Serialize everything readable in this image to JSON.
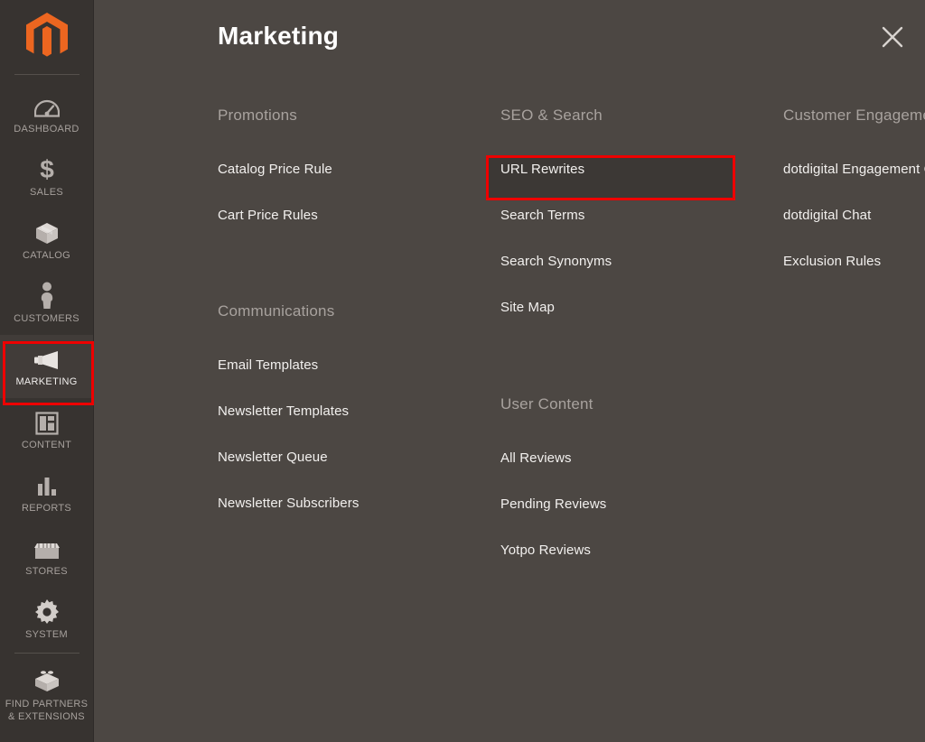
{
  "sidebar": {
    "logo": {
      "icon": "magento-logo-icon",
      "color": "#ec6620"
    },
    "items": [
      {
        "id": "dashboard",
        "label": "DASHBOARD",
        "icon": "dashboard-gauge-icon",
        "active": false
      },
      {
        "id": "sales",
        "label": "SALES",
        "icon": "dollar-sign-icon",
        "active": false
      },
      {
        "id": "catalog",
        "label": "CATALOG",
        "icon": "box-icon",
        "active": false
      },
      {
        "id": "customers",
        "label": "CUSTOMERS",
        "icon": "person-icon",
        "active": false
      },
      {
        "id": "marketing",
        "label": "MARKETING",
        "icon": "megaphone-icon",
        "active": true
      },
      {
        "id": "content",
        "label": "CONTENT",
        "icon": "layout-panel-icon",
        "active": false
      },
      {
        "id": "reports",
        "label": "REPORTS",
        "icon": "bar-chart-icon",
        "active": false
      },
      {
        "id": "stores",
        "label": "STORES",
        "icon": "storefront-icon",
        "active": false
      },
      {
        "id": "system",
        "label": "SYSTEM",
        "icon": "gear-icon",
        "active": false
      },
      {
        "id": "find-partners",
        "label": "FIND PARTNERS\n& EXTENSIONS",
        "label_line1": "FIND PARTNERS",
        "label_line2": "& EXTENSIONS",
        "icon": "lego-brick-icon",
        "active": false
      }
    ]
  },
  "panel": {
    "title": "Marketing",
    "close_icon": "close-x-icon",
    "groups": [
      {
        "id": "promotions",
        "title": "Promotions",
        "items": [
          {
            "label": "Catalog Price Rule",
            "highlighted": false
          },
          {
            "label": "Cart Price Rules",
            "highlighted": false
          }
        ]
      },
      {
        "id": "communications",
        "title": "Communications",
        "items": [
          {
            "label": "Email Templates",
            "highlighted": false
          },
          {
            "label": "Newsletter Templates",
            "highlighted": false
          },
          {
            "label": "Newsletter Queue",
            "highlighted": false
          },
          {
            "label": "Newsletter Subscribers",
            "highlighted": false
          }
        ]
      },
      {
        "id": "seo-search",
        "title": "SEO & Search",
        "items": [
          {
            "label": "URL Rewrites",
            "highlighted": true
          },
          {
            "label": "Search Terms",
            "highlighted": false
          },
          {
            "label": "Search Synonyms",
            "highlighted": false
          },
          {
            "label": "Site Map",
            "highlighted": false
          }
        ]
      },
      {
        "id": "user-content",
        "title": "User Content",
        "items": [
          {
            "label": "All Reviews",
            "highlighted": false
          },
          {
            "label": "Pending Reviews",
            "highlighted": false
          },
          {
            "label": "Yotpo Reviews",
            "highlighted": false
          }
        ]
      },
      {
        "id": "customer-engagement",
        "title": "Customer Engagement",
        "items": [
          {
            "label": "dotdigital Engagement Cloud",
            "highlighted": false
          },
          {
            "label": "dotdigital Chat",
            "highlighted": false
          },
          {
            "label": "Exclusion Rules",
            "highlighted": false
          }
        ]
      }
    ]
  },
  "highlights": {
    "color": "#ee0000",
    "sidebar_target": "MARKETING",
    "menu_target": "URL Rewrites"
  },
  "colors": {
    "sidebar_bg": "#373330",
    "panel_bg": "#4c4743",
    "active_item_bg": "#413c39",
    "accent_orange": "#ec6620",
    "heading_gray": "#a8a29e",
    "item_text": "#f2f0ee",
    "highlight_red": "#ee0000"
  }
}
